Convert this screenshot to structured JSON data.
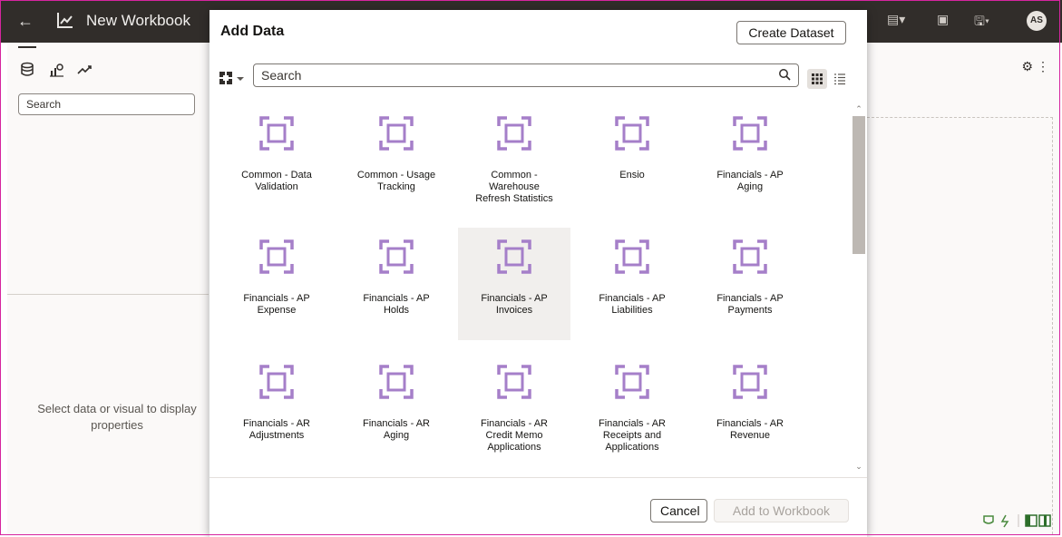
{
  "topbar": {
    "back_icon": "arrow-left-icon",
    "workbook_icon": "chart-icon",
    "title": "New Workbook",
    "avatar_initials": "AS"
  },
  "left_panel": {
    "tabs": [
      "data-icon",
      "visualizations-icon",
      "analytics-icon"
    ],
    "search_placeholder": "Search",
    "hint": "Select data or visual to display properties"
  },
  "modal": {
    "title": "Add Data",
    "create_dataset_label": "Create Dataset",
    "search_placeholder": "Search",
    "cancel_label": "Cancel",
    "add_label": "Add to Workbook",
    "selected_item": "Financials - AP Invoices",
    "items": [
      [
        "Common - Data",
        "Validation",
        ""
      ],
      [
        "Common - Usage",
        "Tracking",
        ""
      ],
      [
        "Common -",
        "Warehouse",
        "Refresh Statistics"
      ],
      [
        "Ensio",
        "",
        ""
      ],
      [
        "Financials - AP",
        "Aging",
        ""
      ],
      [
        "Financials - AP",
        "Expense",
        ""
      ],
      [
        "Financials - AP",
        "Holds",
        ""
      ],
      [
        "Financials - AP",
        "Invoices",
        ""
      ],
      [
        "Financials - AP",
        "Liabilities",
        ""
      ],
      [
        "Financials - AP",
        "Payments",
        ""
      ],
      [
        "Financials - AR",
        "Adjustments",
        ""
      ],
      [
        "Financials - AR",
        "Aging",
        ""
      ],
      [
        "Financials - AR",
        "Credit Memo",
        "Applications"
      ],
      [
        "Financials - AR",
        "Receipts and",
        "Applications"
      ],
      [
        "Financials - AR",
        "Revenue",
        ""
      ]
    ]
  },
  "colors": {
    "topbar": "#312d2a",
    "icon_purple": "#a57fc9",
    "frame_border": "#d6249f"
  }
}
